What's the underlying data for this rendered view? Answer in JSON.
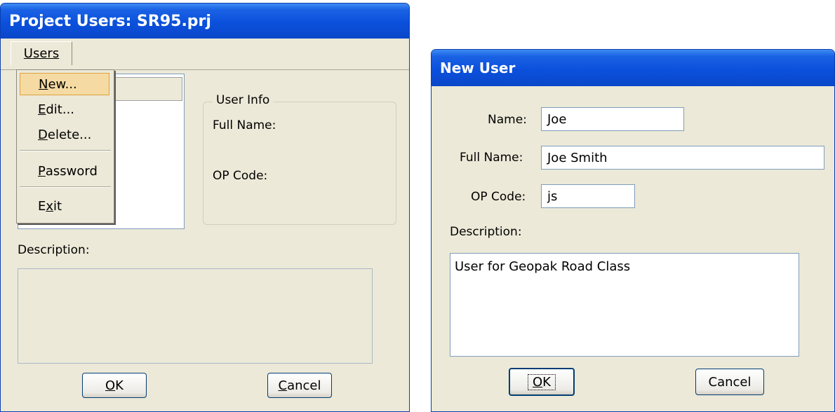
{
  "project_users_window": {
    "title": "Project Users: SR95.prj",
    "menubar": {
      "users_menu": "Users"
    },
    "dropdown": {
      "items": [
        {
          "label": "New...",
          "underline": "N",
          "rest": "ew..."
        },
        {
          "label": "Edit...",
          "underline": "E",
          "rest": "dit..."
        },
        {
          "label": "Delete...",
          "underline": "D",
          "rest": "elete..."
        },
        {
          "label": "Password",
          "underline": "P",
          "rest": "assword"
        },
        {
          "label": "Exit",
          "pre": "E",
          "underline": "x",
          "rest": "it"
        }
      ]
    },
    "user_info": {
      "group_label": "User Info",
      "full_name_label": "Full Name:",
      "op_code_label": "OP Code:"
    },
    "description_label": "Description:",
    "ok_button": {
      "underline": "O",
      "rest": "K"
    },
    "cancel_button": {
      "underline": "C",
      "rest": "ancel"
    }
  },
  "new_user_window": {
    "title": "New User",
    "name_label": "Name:",
    "name_value": "Joe",
    "full_name_label": "Full Name:",
    "full_name_value": "Joe Smith",
    "op_code_label": "OP Code:",
    "op_code_value": "js",
    "description_label": "Description:",
    "description_value": "User for Geopak Road Class",
    "ok_button": {
      "underline": "O",
      "rest": "K"
    },
    "cancel_button": "Cancel"
  }
}
